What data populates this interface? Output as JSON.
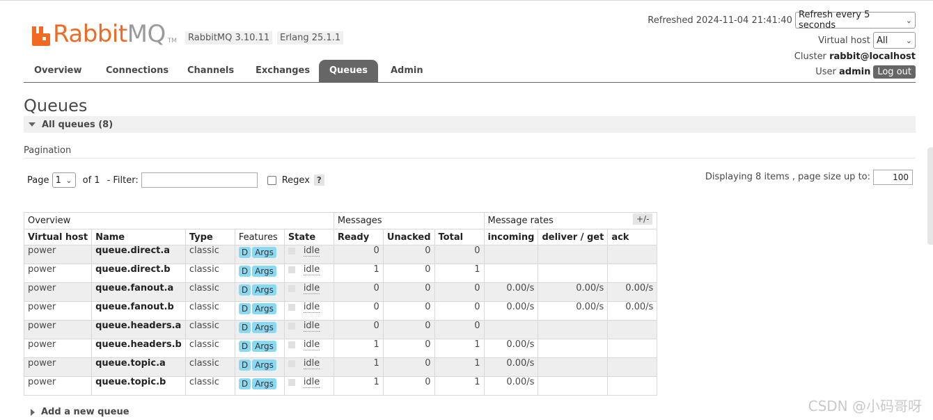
{
  "header": {
    "logo_rabbit": "Rabbit",
    "logo_mq": "MQ",
    "logo_tm": "TM",
    "rabbitmq_version": "RabbitMQ 3.10.11",
    "erlang_version": "Erlang 25.1.1",
    "refreshed_label": "Refreshed",
    "refreshed_time": "2024-11-04 21:41:40",
    "refresh_select": "Refresh every 5 seconds",
    "vhost_label": "Virtual host",
    "vhost_select": "All",
    "cluster_label": "Cluster",
    "cluster_name": "rabbit@localhost",
    "user_label": "User",
    "user_name": "admin",
    "logout_label": "Log out"
  },
  "tabs": [
    {
      "label": "Overview"
    },
    {
      "label": "Connections"
    },
    {
      "label": "Channels"
    },
    {
      "label": "Exchanges"
    },
    {
      "label": "Queues",
      "active": true
    },
    {
      "label": "Admin"
    }
  ],
  "page": {
    "title": "Queues",
    "section_label": "All queues (8)",
    "pagination_label": "Pagination",
    "page_label": "Page",
    "page_select": "1",
    "of_label": "of 1",
    "filter_label": "- Filter:",
    "filter_value": "",
    "regex_label": "Regex",
    "help_label": "?",
    "displaying_text": "Displaying 8 items , page size up to:",
    "page_size": "100",
    "plusminus": "+/-",
    "add_queue": "Add a new queue"
  },
  "table": {
    "groups": [
      "Overview",
      "Messages",
      "Message rates"
    ],
    "columns": [
      "Virtual host",
      "Name",
      "Type",
      "Features",
      "State",
      "Ready",
      "Unacked",
      "Total",
      "incoming",
      "deliver / get",
      "ack"
    ],
    "feature_d": "D",
    "feature_args": "Args",
    "rows": [
      {
        "vhost": "power",
        "name": "queue.direct.a",
        "type": "classic",
        "state": "idle",
        "ready": "0",
        "unacked": "0",
        "total": "0",
        "incoming": "",
        "deliver": "",
        "ack": ""
      },
      {
        "vhost": "power",
        "name": "queue.direct.b",
        "type": "classic",
        "state": "idle",
        "ready": "1",
        "unacked": "0",
        "total": "1",
        "incoming": "",
        "deliver": "",
        "ack": ""
      },
      {
        "vhost": "power",
        "name": "queue.fanout.a",
        "type": "classic",
        "state": "idle",
        "ready": "0",
        "unacked": "0",
        "total": "0",
        "incoming": "0.00/s",
        "deliver": "0.00/s",
        "ack": "0.00/s"
      },
      {
        "vhost": "power",
        "name": "queue.fanout.b",
        "type": "classic",
        "state": "idle",
        "ready": "0",
        "unacked": "0",
        "total": "0",
        "incoming": "0.00/s",
        "deliver": "0.00/s",
        "ack": "0.00/s"
      },
      {
        "vhost": "power",
        "name": "queue.headers.a",
        "type": "classic",
        "state": "idle",
        "ready": "0",
        "unacked": "0",
        "total": "0",
        "incoming": "",
        "deliver": "",
        "ack": ""
      },
      {
        "vhost": "power",
        "name": "queue.headers.b",
        "type": "classic",
        "state": "idle",
        "ready": "1",
        "unacked": "0",
        "total": "1",
        "incoming": "0.00/s",
        "deliver": "",
        "ack": ""
      },
      {
        "vhost": "power",
        "name": "queue.topic.a",
        "type": "classic",
        "state": "idle",
        "ready": "1",
        "unacked": "0",
        "total": "1",
        "incoming": "0.00/s",
        "deliver": "",
        "ack": ""
      },
      {
        "vhost": "power",
        "name": "queue.topic.b",
        "type": "classic",
        "state": "idle",
        "ready": "1",
        "unacked": "0",
        "total": "1",
        "incoming": "0.00/s",
        "deliver": "",
        "ack": ""
      }
    ]
  },
  "watermark": "CSDN @小码哥呀",
  "colors": {
    "brand_orange": "#f26a1f",
    "tab_active": "#666666",
    "feature_badge": "#8ad9f2"
  }
}
